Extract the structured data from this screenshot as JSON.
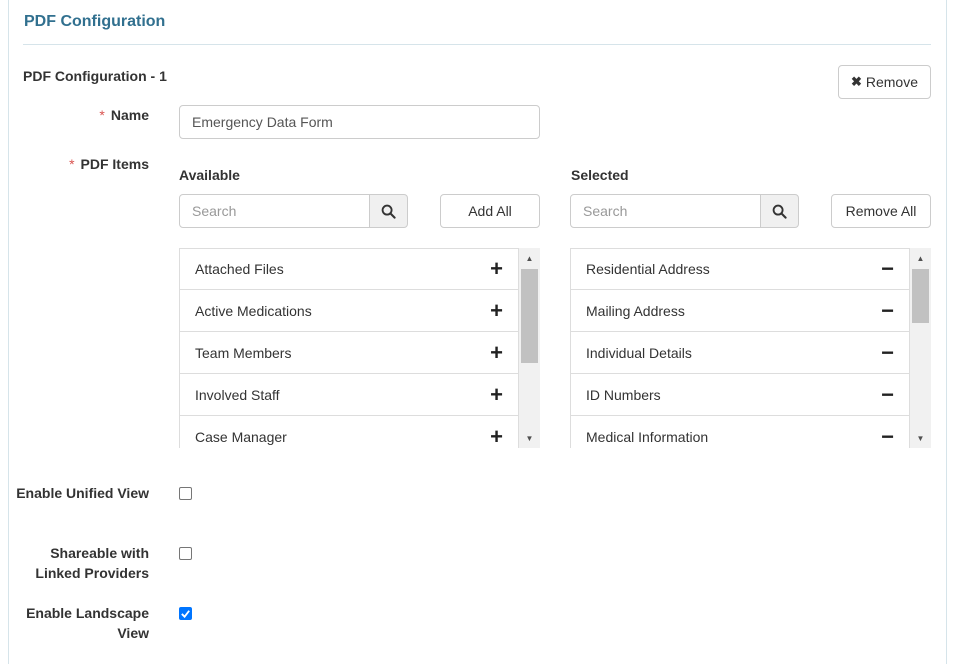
{
  "panel": {
    "title": "PDF Configuration"
  },
  "config": {
    "section_title": "PDF Configuration - 1",
    "remove_label": "Remove",
    "name_label": "Name",
    "name_value": "Emergency Data Form",
    "items_label": "PDF Items",
    "required_mark": "*"
  },
  "available": {
    "heading": "Available",
    "search_placeholder": "Search",
    "add_all_label": "Add All",
    "items": [
      "Attached Files",
      "Active Medications",
      "Team Members",
      "Involved Staff",
      "Case Manager"
    ]
  },
  "selected": {
    "heading": "Selected",
    "search_placeholder": "Search",
    "remove_all_label": "Remove All",
    "items": [
      "Residential Address",
      "Mailing Address",
      "Individual Details",
      "ID Numbers",
      "Medical Information"
    ]
  },
  "options": {
    "unified_label": "Enable Unified View",
    "unified_checked": false,
    "share_label": "Shareable with Linked Providers",
    "share_checked": false,
    "landscape_label": "Enable Landscape View",
    "landscape_checked": true
  },
  "colors": {
    "accent": "#31708f",
    "required": "#d9534f",
    "checkbox": "#0075ff"
  }
}
